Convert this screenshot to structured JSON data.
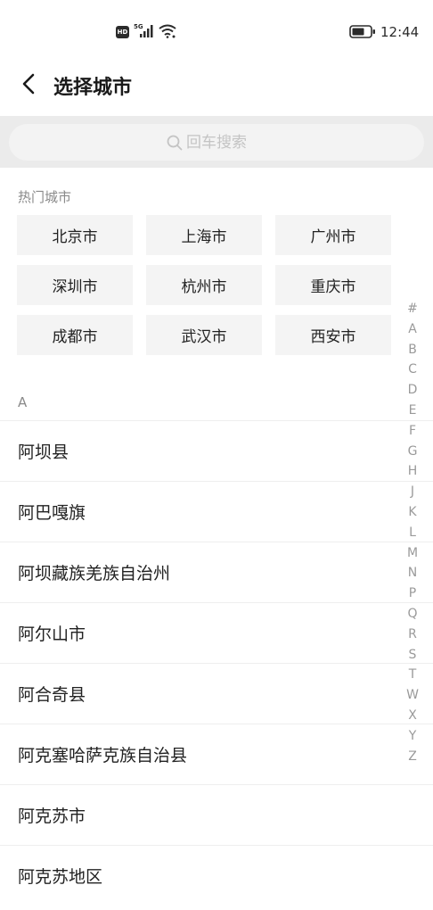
{
  "status_bar": {
    "hd_label": "HD",
    "network_label": "5G",
    "time": "12:44",
    "icons": [
      "signal-icon",
      "wifi-icon",
      "battery-icon"
    ]
  },
  "header": {
    "title": "选择城市",
    "back_icon": "chevron-left-icon"
  },
  "search": {
    "placeholder": "回车搜索",
    "value": "",
    "icon": "search-icon"
  },
  "hot_cities": {
    "title": "热门城市",
    "items": [
      "北京市",
      "上海市",
      "广州市",
      "深圳市",
      "杭州市",
      "重庆市",
      "成都市",
      "武汉市",
      "西安市"
    ]
  },
  "city_list": {
    "section_letter": "A",
    "items": [
      "阿坝县",
      "阿巴嘎旗",
      "阿坝藏族羌族自治州",
      "阿尔山市",
      "阿合奇县",
      "阿克塞哈萨克族自治县",
      "阿克苏市",
      "阿克苏地区"
    ]
  },
  "index_bar": {
    "letters": [
      "#",
      "A",
      "B",
      "C",
      "D",
      "E",
      "F",
      "G",
      "H",
      "J",
      "K",
      "L",
      "M",
      "N",
      "P",
      "Q",
      "R",
      "S",
      "T",
      "W",
      "X",
      "Y",
      "Z"
    ]
  },
  "colors": {
    "search_band": "#ebebeb",
    "search_box": "#f3f3f3",
    "hot_cell": "#f4f4f4",
    "muted_text": "#8a8a8a"
  }
}
